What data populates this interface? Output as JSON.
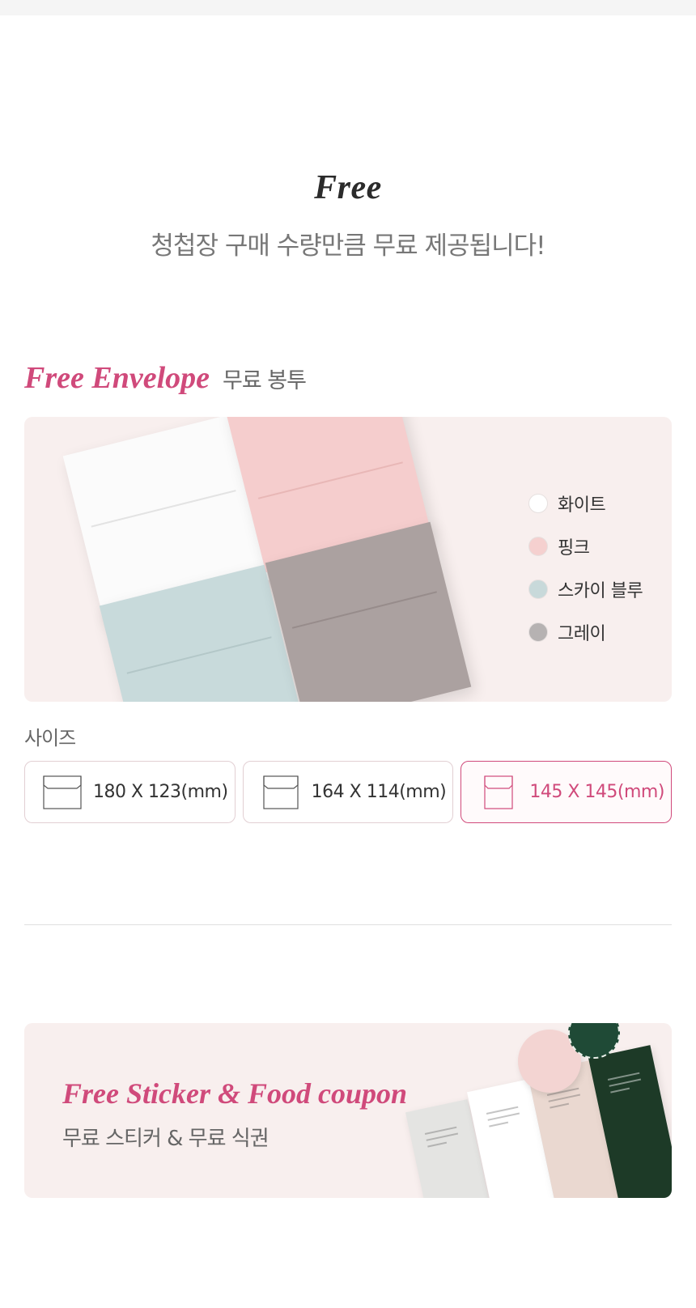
{
  "intro": {
    "title": "Free",
    "subtitle": "청첩장 구매 수량만큼 무료 제공됩니다!"
  },
  "envelope": {
    "title_en": "Free Envelope",
    "title_ko": "무료 봉투",
    "colors": [
      {
        "label": "화이트",
        "hex": "#ffffff"
      },
      {
        "label": "핑크",
        "hex": "#f5d0cf"
      },
      {
        "label": "스카이 블루",
        "hex": "#c8d9da"
      },
      {
        "label": "그레이",
        "hex": "#b6b2b2"
      }
    ],
    "size_label": "사이즈",
    "sizes": [
      {
        "label": "180 X 123(mm)",
        "selected": false
      },
      {
        "label": "164 X 114(mm)",
        "selected": false
      },
      {
        "label": "145 X 145(mm)",
        "selected": true
      }
    ],
    "accent_color": "#d04a7b"
  },
  "sticker": {
    "title_en": "Free Sticker & Food coupon",
    "title_ko": "무료 스티커 & 무료 식권"
  }
}
